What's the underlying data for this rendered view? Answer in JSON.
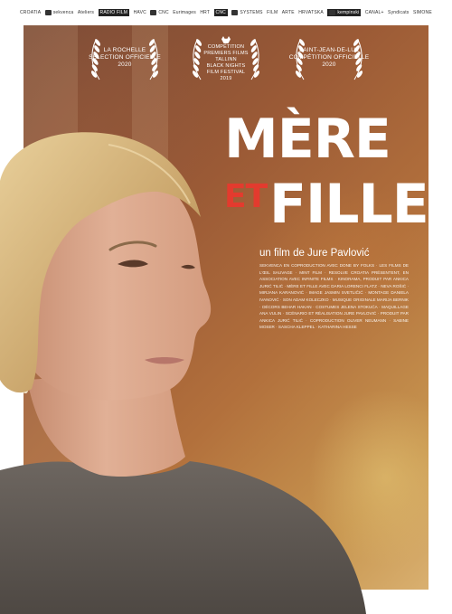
{
  "logos": [
    {
      "name": "logo-1",
      "label": "CROATIA"
    },
    {
      "name": "logo-2",
      "label": "sekvenca"
    },
    {
      "name": "logo-3",
      "label": "Ateliers"
    },
    {
      "name": "logo-4",
      "label": "RADIO FILM"
    },
    {
      "name": "logo-5",
      "label": "HAVC"
    },
    {
      "name": "logo-6",
      "label": "CNC"
    },
    {
      "name": "logo-7",
      "label": "Eurimages"
    },
    {
      "name": "logo-8",
      "label": "HRT"
    },
    {
      "name": "logo-9",
      "label": "CNC"
    },
    {
      "name": "logo-10",
      "label": "SYSTEMS"
    },
    {
      "name": "logo-11",
      "label": "FILM"
    },
    {
      "name": "logo-12",
      "label": "ARTE"
    },
    {
      "name": "logo-13",
      "label": "HRVATSKA"
    },
    {
      "name": "logo-14",
      "label": "kempinski"
    },
    {
      "name": "logo-15",
      "label": "CANAL+"
    },
    {
      "name": "logo-16",
      "label": "Syndicats"
    },
    {
      "name": "logo-17",
      "label": "SIMONE"
    }
  ],
  "laurels": [
    {
      "lines": [
        "LA ROCHELLE",
        "SÉLECTION OFFICIELLE",
        "2020"
      ]
    },
    {
      "lines": [
        "COMPÉTITION",
        "PREMIERS FILMS",
        "TALLINN",
        "BLACK NIGHTS",
        "FILM FESTIVAL",
        "2019"
      ]
    },
    {
      "lines": [
        "SAINT-JEAN-DE-LUZ",
        "COMPÉTITION OFFICIELLE",
        "2020"
      ]
    }
  ],
  "title": {
    "line1": "MÈRE",
    "line2_accent": "ET",
    "line2": "FILLE"
  },
  "director": "un film de Jure Pavlović",
  "credits": "SEKVENCA en coproduction avec DONE BY FOLKS · LES FILMS DE L'ŒIL SAUVAGE · MINT FILM · RESOLVE CROATIA présentent, en association avec INFINITE FILMS · KINORAMA, produit par ANKICA JURIĆ TILIĆ · MÈRE ET FILLE avec DARIA LORENCI FLATZ · NEVA ROŠIĆ · MIRJANA KARANOVIĆ · image JASMIN SVETLIČIĆ · montage DANIELA IVANOVIĆ · son ADAM KOLECZKO · musique originale MARIJA BERNIK · décors BEHAR HAKAN · costumes JELENA STOKUĆA · maquillage ANA VULIN · scénario et réalisation JURE PAVLOVIĆ · produit par ANKICA JURIĆ TILIĆ · coproduction OLIVER NEUMANN · SABINE MOSER · SASCHA KLEPPEL · KATHARINA HESSE"
}
